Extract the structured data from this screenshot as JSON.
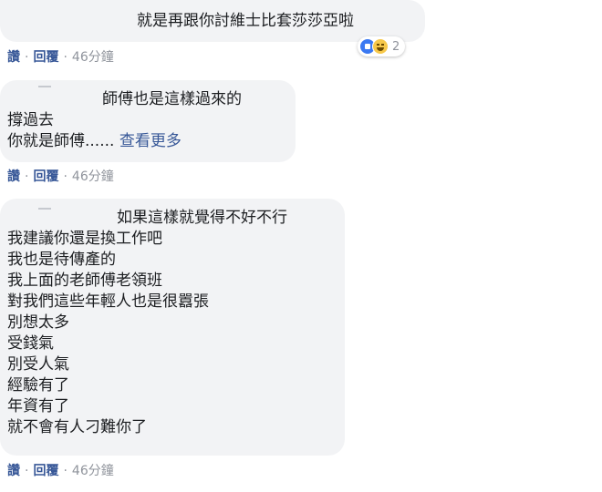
{
  "comments": [
    {
      "lines": [
        "就是再跟你討維士比套莎莎亞啦"
      ],
      "actions": {
        "like": "讚",
        "reply": "回覆",
        "time": "46分鐘"
      },
      "reactions": {
        "icons": [
          "like-icon",
          "haha-icon"
        ],
        "count": "2"
      }
    },
    {
      "lines": [
        "師傅也是這樣過來的",
        "撐過去",
        "你就是師傅......"
      ],
      "see_more": "查看更多",
      "actions": {
        "like": "讚",
        "reply": "回覆",
        "time": "46分鐘"
      }
    },
    {
      "lines": [
        "如果這樣就覺得不好不行",
        "我建議你還是換工作吧",
        "我也是待傳產的",
        "我上面的老師傅老領班",
        "對我們這些年輕人也是很囂張",
        "別想太多",
        "受錢氣",
        "別受人氣",
        "經驗有了",
        "年資有了",
        "就不會有人刁難你了"
      ],
      "actions": {
        "like": "讚",
        "reply": "回覆",
        "time": "46分鐘"
      }
    }
  ],
  "colors": {
    "bubble_bg": "#f2f3f5",
    "link": "#385898",
    "meta": "#90949c",
    "text": "#1c1e21"
  }
}
